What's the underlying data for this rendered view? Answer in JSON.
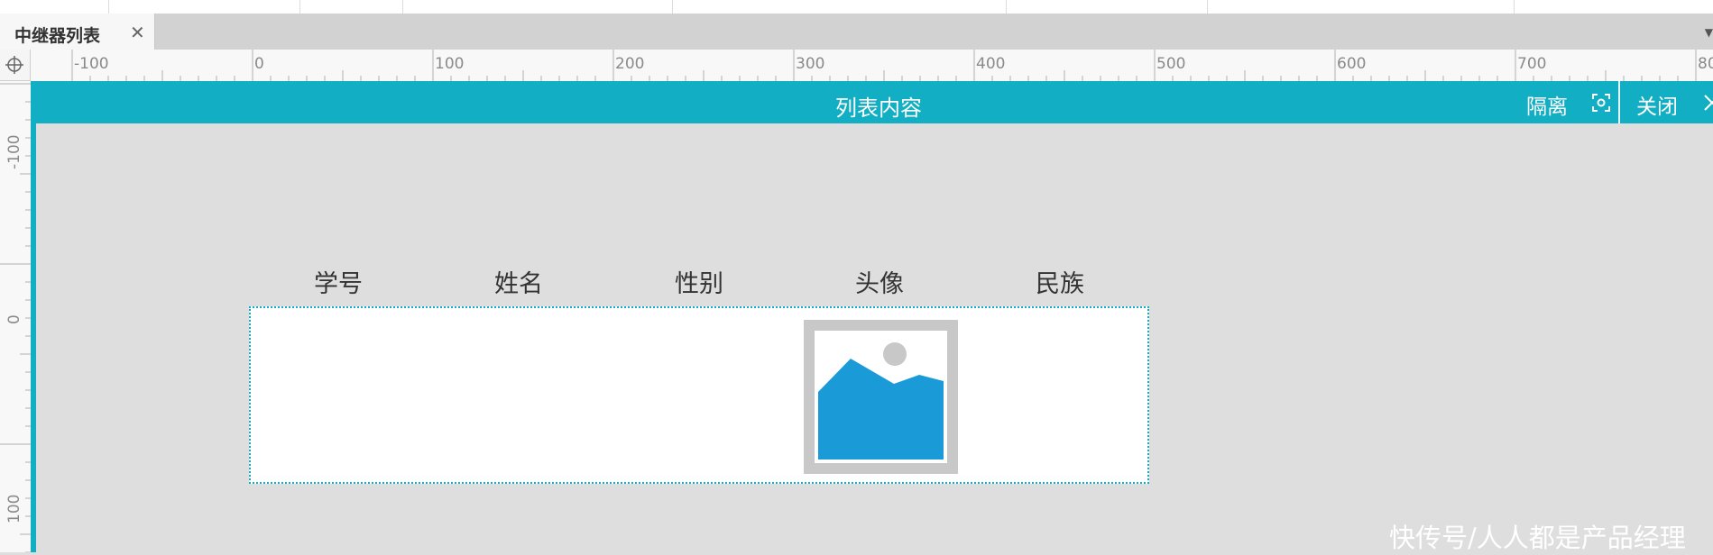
{
  "tab": {
    "title": "中继器列表",
    "close_icon": "close-icon"
  },
  "ruler": {
    "horizontal_labels": [
      "-100",
      "0",
      "100",
      "200",
      "300",
      "400",
      "500",
      "600",
      "700",
      "80"
    ],
    "vertical_labels": [
      "-100",
      "0",
      "100"
    ]
  },
  "panel": {
    "title": "列表内容",
    "isolate_label": "隔离",
    "close_label": "关闭",
    "accent_color": "#12aec3"
  },
  "table": {
    "columns": [
      "学号",
      "姓名",
      "性别",
      "头像",
      "民族"
    ],
    "avatar_icon": "image-placeholder-icon"
  },
  "watermark": "快传号/人人都是产品经理"
}
